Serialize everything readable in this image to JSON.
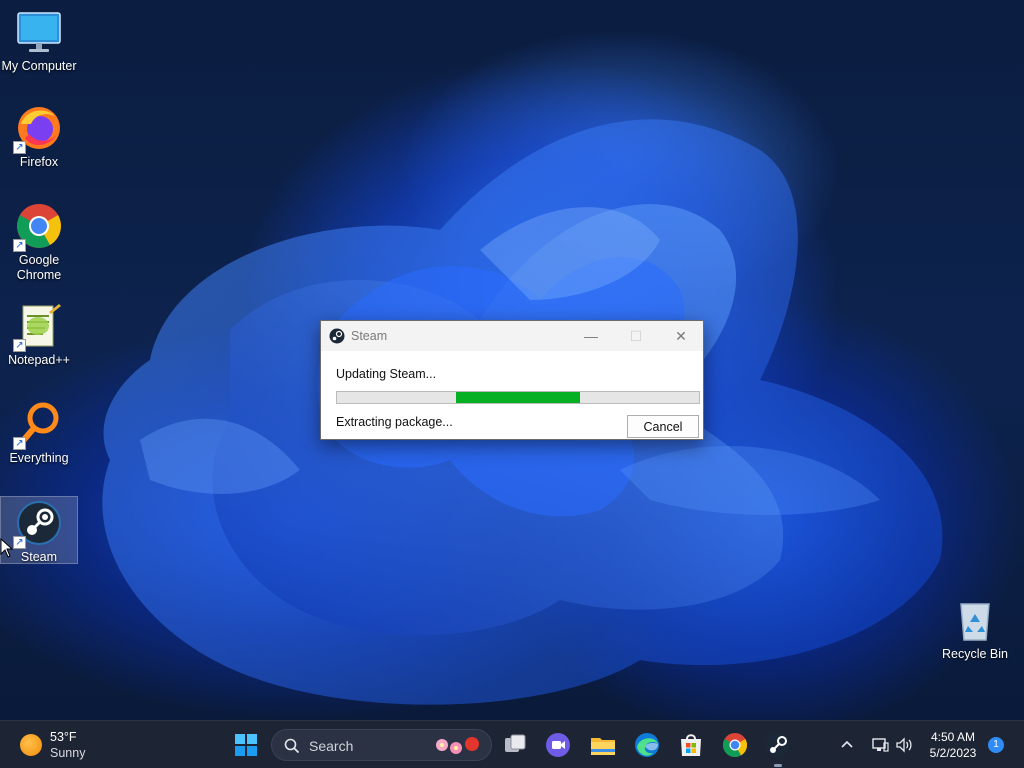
{
  "desktop": {
    "icons": [
      {
        "label": "My Computer"
      },
      {
        "label": "Firefox"
      },
      {
        "label": "Google Chrome"
      },
      {
        "label": "Notepad++"
      },
      {
        "label": "Everything"
      },
      {
        "label": "Steam"
      },
      {
        "label": "Recycle Bin"
      }
    ]
  },
  "dialog": {
    "title": "Steam",
    "status": "Updating Steam...",
    "detail": "Extracting package...",
    "cancel_label": "Cancel",
    "progress": {
      "start": 0.33,
      "end": 0.67
    },
    "progress_color": "#06b025"
  },
  "taskbar": {
    "weather": {
      "temp": "53°F",
      "condition": "Sunny"
    },
    "search_placeholder": "Search",
    "clock": {
      "time": "4:50 AM",
      "date": "5/2/2023"
    },
    "notification_count": "1",
    "pinned": [
      "start-icon",
      "search-icon",
      "task-view-icon",
      "meet-icon",
      "file-explorer-icon",
      "edge-icon",
      "store-icon",
      "chrome-icon",
      "steam-icon"
    ]
  },
  "colors": {
    "accent": "#0a5cff",
    "taskbar_bg": "#1d2433"
  }
}
